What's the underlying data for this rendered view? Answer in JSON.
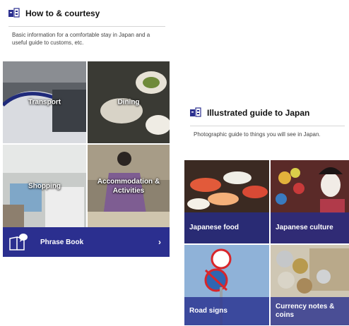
{
  "left_section": {
    "title": "How to & courtesy",
    "description": "Basic information for a comfortable stay in Japan and a useful guide to customs, etc.",
    "tiles": [
      {
        "label": "Transport"
      },
      {
        "label": "Dining"
      },
      {
        "label": "Shopping"
      },
      {
        "label": "Accommodation & Activities"
      }
    ],
    "phrase_book": {
      "label": "Phrase Book",
      "chevron": "›"
    }
  },
  "right_section": {
    "title": "Illustrated guide to Japan",
    "description": "Photographic guide to things you will see in Japan.",
    "tiles": [
      {
        "label": "Japanese food"
      },
      {
        "label": "Japanese culture"
      },
      {
        "label": "Road signs"
      },
      {
        "label": "Currency notes & coins"
      }
    ]
  },
  "icons": {
    "section_logo": "japan-guide-logo-icon",
    "phrase_book": "book-speech-bubble-icon",
    "chevron": "chevron-right-icon"
  },
  "colors": {
    "accent_blue": "#2b2f8f",
    "band_blue": "#242c8c"
  }
}
